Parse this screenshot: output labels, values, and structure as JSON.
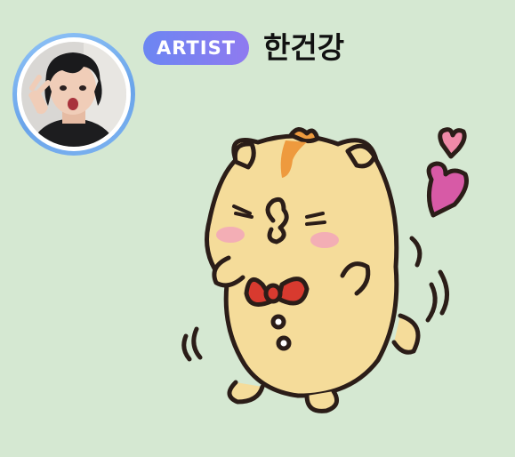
{
  "header": {
    "badge_label": "ARTIST",
    "username": "한건강"
  },
  "avatar": {
    "icon": "avatar-photo",
    "ring_color": "#7fb4f2"
  },
  "sticker": {
    "icon": "hamster-kiss-sticker",
    "colors": {
      "body": "#f5dc9a",
      "stripe": "#ee9a3e",
      "bow": "#d83a2f",
      "blush": "#f3a8b8",
      "heart": "#d75aa6"
    }
  },
  "theme": {
    "background": "#d5e8d2",
    "badge_gradient": [
      "#6c86f2",
      "#8f7af0"
    ]
  }
}
